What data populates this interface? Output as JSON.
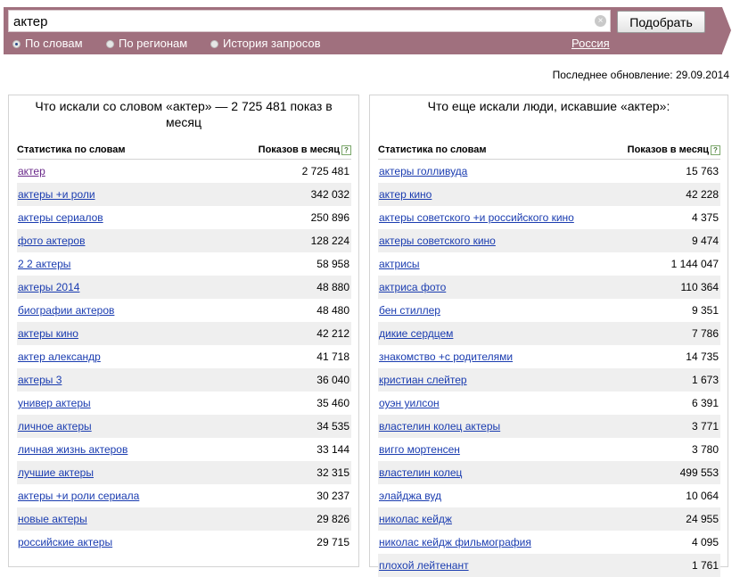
{
  "search": {
    "query": "актер",
    "button_label": "Подобрать",
    "clear_icon": "×"
  },
  "modes": [
    {
      "label": "По словам",
      "selected": true
    },
    {
      "label": "По регионам",
      "selected": false
    },
    {
      "label": "История запросов",
      "selected": false
    }
  ],
  "region": "Россия",
  "updated": "Последнее обновление: 29.09.2014",
  "left_panel": {
    "title": "Что искали со словом «актер» — 2 725 481 показ в месяц",
    "col_words": "Статистика по словам",
    "col_shows": "Показов в месяц",
    "help": "?",
    "rows": [
      {
        "kw": "актер",
        "num": "2 725 481"
      },
      {
        "kw": "актеры +и роли",
        "num": "342 032"
      },
      {
        "kw": "актеры сериалов",
        "num": "250 896"
      },
      {
        "kw": "фото актеров",
        "num": "128 224"
      },
      {
        "kw": "2 2 актеры",
        "num": "58 958"
      },
      {
        "kw": "актеры 2014",
        "num": "48 880"
      },
      {
        "kw": "биографии актеров",
        "num": "48 480"
      },
      {
        "kw": "актеры кино",
        "num": "42 212"
      },
      {
        "kw": "актер александр",
        "num": "41 718"
      },
      {
        "kw": "актеры 3",
        "num": "36 040"
      },
      {
        "kw": "универ актеры",
        "num": "35 460"
      },
      {
        "kw": "личное актеры",
        "num": "34 535"
      },
      {
        "kw": "личная жизнь актеров",
        "num": "33 144"
      },
      {
        "kw": "лучшие актеры",
        "num": "32 315"
      },
      {
        "kw": "актеры +и роли сериала",
        "num": "30 237"
      },
      {
        "kw": "новые актеры",
        "num": "29 826"
      },
      {
        "kw": "российские актеры",
        "num": "29 715"
      }
    ]
  },
  "right_panel": {
    "title": "Что еще искали люди, искавшие «актер»:",
    "col_words": "Статистика по словам",
    "col_shows": "Показов в месяц",
    "help": "?",
    "rows": [
      {
        "kw": "актеры голливуда",
        "num": "15 763"
      },
      {
        "kw": "актер кино",
        "num": "42 228"
      },
      {
        "kw": "актеры советского +и российского кино",
        "num": "4 375"
      },
      {
        "kw": "актеры советского кино",
        "num": "9 474"
      },
      {
        "kw": "актрисы",
        "num": "1 144 047"
      },
      {
        "kw": "актриса фото",
        "num": "110 364"
      },
      {
        "kw": "бен стиллер",
        "num": "9 351"
      },
      {
        "kw": "дикие сердцем",
        "num": "7 786"
      },
      {
        "kw": "знакомство +с родителями",
        "num": "14 735"
      },
      {
        "kw": "кристиан слейтер",
        "num": "1 673"
      },
      {
        "kw": "оуэн уилсон",
        "num": "6 391"
      },
      {
        "kw": "властелин колец актеры",
        "num": "3 771"
      },
      {
        "kw": "вигго мортенсен",
        "num": "3 780"
      },
      {
        "kw": "властелин колец",
        "num": "499 553"
      },
      {
        "kw": "элайджа вуд",
        "num": "10 064"
      },
      {
        "kw": "николас кейдж",
        "num": "24 955"
      },
      {
        "kw": "николас кейдж фильмография",
        "num": "4 095"
      },
      {
        "kw": "плохой лейтенант",
        "num": "1 761"
      }
    ]
  }
}
